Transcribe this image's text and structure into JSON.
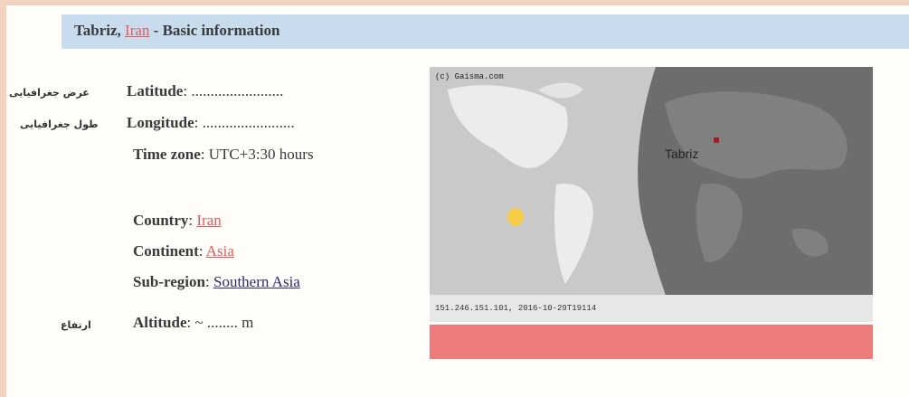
{
  "header": {
    "city": "Tabriz",
    "sep": ",",
    "country_link": "Iran",
    "suffix": " - Basic information"
  },
  "info": {
    "latitude": {
      "label": "Latitude",
      "value": ": ........................",
      "fa_label": "عرض جغرافیایی"
    },
    "longitude": {
      "label": "Longitude",
      "value": ": ........................",
      "fa_label": "طول جغرافیایی"
    },
    "timezone": {
      "label": "Time zone",
      "value": ": UTC+3:30 hours"
    },
    "country": {
      "label": "Country",
      "colon": ": ",
      "value": "Iran"
    },
    "continent": {
      "label": "Continent",
      "colon": ": ",
      "value": "Asia"
    },
    "subregion": {
      "label": "Sub-region",
      "colon": ": ",
      "value": "Southern Asia"
    },
    "altitude": {
      "label": "Altitude",
      "value": ": ~ ........ m",
      "fa_label": "ارتفاع"
    }
  },
  "map": {
    "credit": "(c) Gaisma.com",
    "city_label": "Tabriz",
    "footer_stamp": "151.246.151.101, 2016-10-29T19114"
  },
  "colors": {
    "page_bg": "#f3d2bf",
    "header_bg": "#c8dcee",
    "link_red": "#e35b5b",
    "link_blue": "#2a2a78",
    "bottom_bar": "#ef7a7c",
    "sun": "#f6cc48"
  }
}
